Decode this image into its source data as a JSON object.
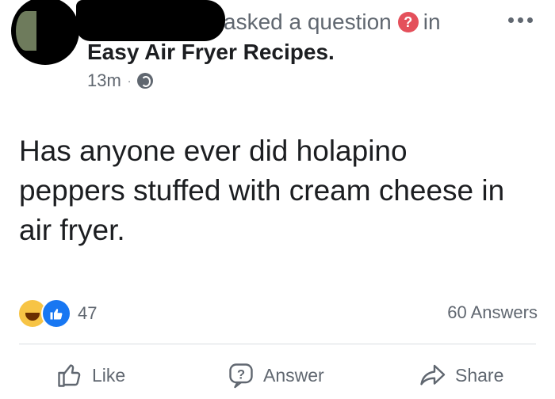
{
  "header": {
    "action_text": "asked a question",
    "in_text": "in",
    "badge_glyph": "?",
    "group_name": "Easy Air Fryer Recipes.",
    "time": "13m",
    "dot": "·",
    "privacy_icon": "globe-icon"
  },
  "post": {
    "text": "Has anyone ever did holapino peppers stuffed with cream cheese in air fryer."
  },
  "stats": {
    "reaction_count": "47",
    "answers_count": "60 Answers"
  },
  "actions": {
    "like": "Like",
    "answer": "Answer",
    "share": "Share"
  },
  "colors": {
    "badge": "#e4505b",
    "like_blue": "#1877f2",
    "haha_yellow": "#f7c445",
    "secondary_text": "#606770"
  }
}
